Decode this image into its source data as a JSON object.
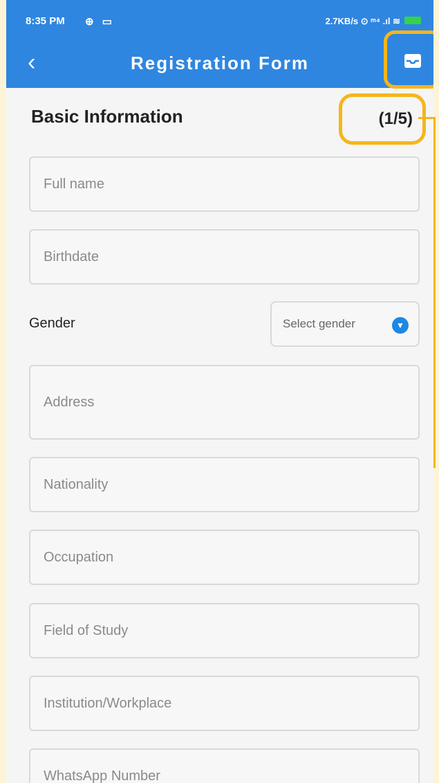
{
  "status_bar": {
    "time": "8:35 PM",
    "time_icons": "⊕ ▭",
    "network": "2.7KB/s ⊙ ᵐ⁴ .ıl ≋"
  },
  "app_bar": {
    "back_icon": "chevron-left-icon",
    "title": "Registration Form",
    "action_icon": "inbox-icon"
  },
  "form": {
    "section_title": "Basic Information",
    "step": "(1/5)",
    "fields": {
      "full_name": "Full name",
      "birthdate": "Birthdate",
      "address": "Address",
      "nationality": "Nationality",
      "occupation": "Occupation",
      "field_of_study": "Field of Study",
      "institution": "Institution/Workplace",
      "whatsapp": "WhatsApp Number"
    },
    "gender": {
      "label": "Gender",
      "placeholder": "Select gender"
    }
  },
  "colors": {
    "primary": "#2f86e0",
    "highlight": "#f5b51c",
    "dropdown_accent": "#1e88e5"
  }
}
